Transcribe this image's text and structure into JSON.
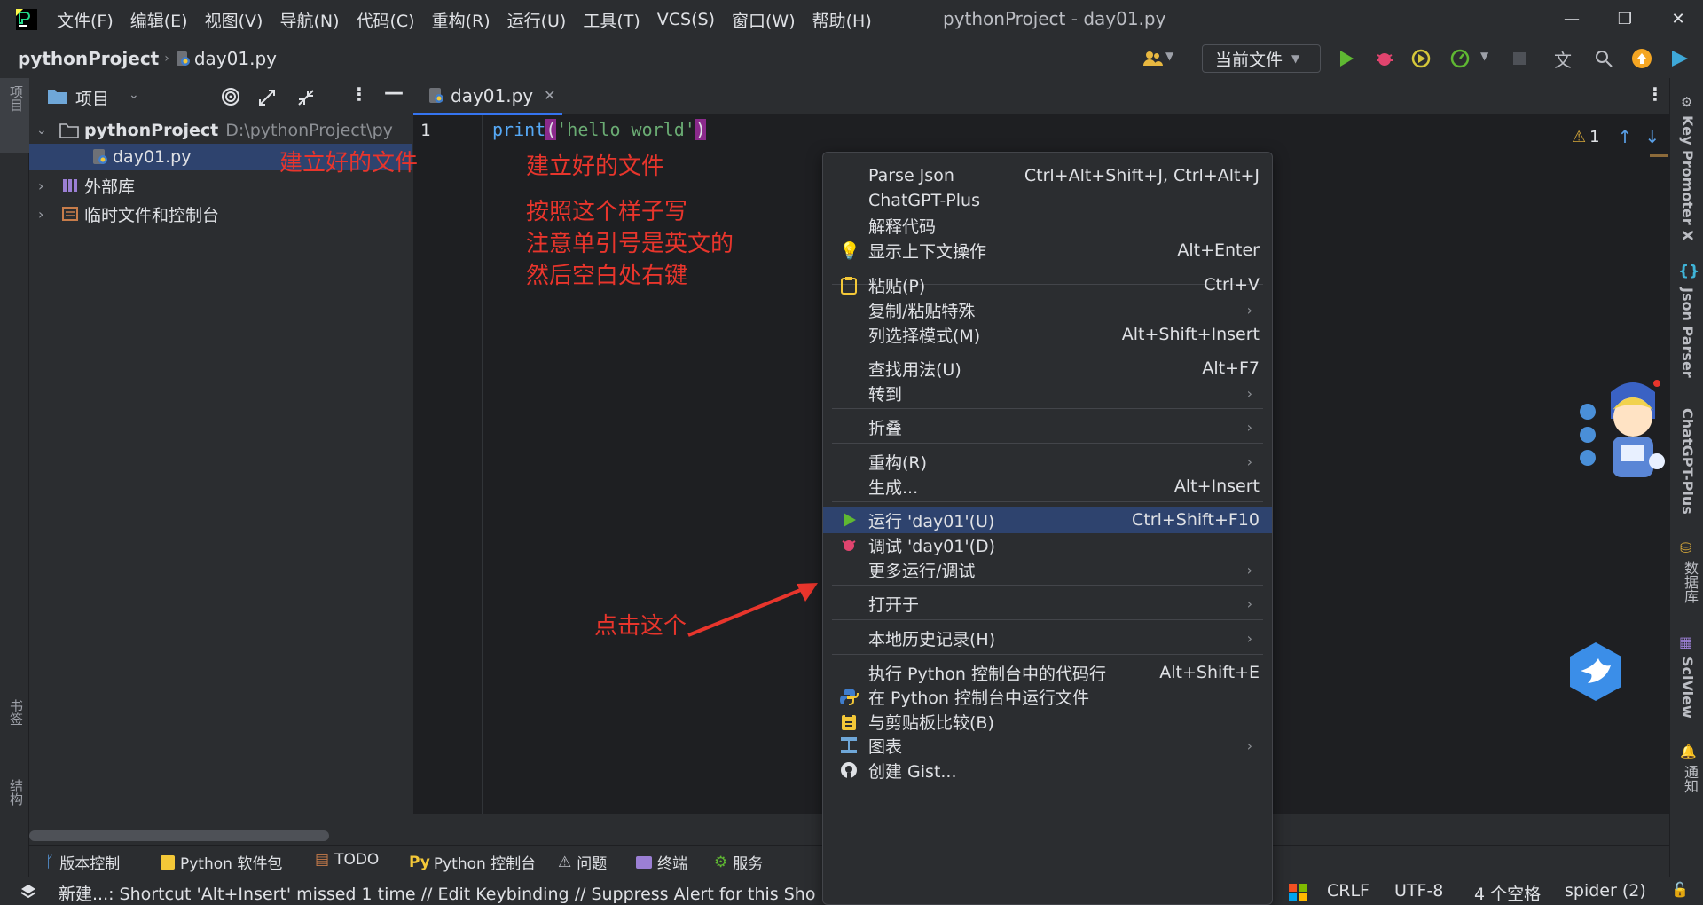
{
  "window": {
    "title": "pythonProject - day01.py",
    "menu": [
      "文件(F)",
      "编辑(E)",
      "视图(V)",
      "导航(N)",
      "代码(C)",
      "重构(R)",
      "运行(U)",
      "工具(T)",
      "VCS(S)",
      "窗口(W)",
      "帮助(H)"
    ],
    "controls": {
      "minimize": "—",
      "restore": "❐",
      "close": "✕"
    }
  },
  "navbar": {
    "project": "pythonProject",
    "file": "day01.py",
    "run_config": "当前文件"
  },
  "left_strip": {
    "project_label": "项目",
    "bookmarks_label": "书签",
    "structure_label": "结构"
  },
  "project_panel": {
    "header_label": "项目",
    "tree": [
      {
        "name": "pythonProject",
        "path": "D:\\pythonProject\\py"
      },
      {
        "name": "day01.py"
      },
      {
        "name": "外部库"
      },
      {
        "name": "临时文件和控制台"
      }
    ]
  },
  "editor": {
    "tab_label": "day01.py",
    "line_number": "1",
    "code": {
      "func": "print",
      "open": "(",
      "string": "'hello world'",
      "close": ")"
    },
    "inspection_count": "1"
  },
  "annotations": {
    "file_created": "建立好的文件",
    "instructions": [
      "按照这个样子写",
      "注意单引号是英文的",
      "然后空白处右键"
    ],
    "click_this": "点击这个"
  },
  "context_menu": {
    "items": [
      {
        "label": "Parse Json",
        "shortcut": "Ctrl+Alt+Shift+J, Ctrl+Alt+J"
      },
      {
        "label": "ChatGPT-Plus",
        "shortcut": ""
      },
      {
        "label": "解释代码",
        "shortcut": ""
      },
      {
        "label": "显示上下文操作",
        "shortcut": "Alt+Enter"
      },
      {
        "label": "粘贴(P)",
        "shortcut": "Ctrl+V"
      },
      {
        "label": "复制/粘贴特殊",
        "shortcut": ""
      },
      {
        "label": "列选择模式(M)",
        "shortcut": "Alt+Shift+Insert"
      },
      {
        "label": "查找用法(U)",
        "shortcut": "Alt+F7"
      },
      {
        "label": "转到",
        "shortcut": ""
      },
      {
        "label": "折叠",
        "shortcut": ""
      },
      {
        "label": "重构(R)",
        "shortcut": ""
      },
      {
        "label": "生成...",
        "shortcut": "Alt+Insert"
      },
      {
        "label": "运行 'day01'(U)",
        "shortcut": "Ctrl+Shift+F10"
      },
      {
        "label": "调试 'day01'(D)",
        "shortcut": ""
      },
      {
        "label": "更多运行/调试",
        "shortcut": ""
      },
      {
        "label": "打开于",
        "shortcut": ""
      },
      {
        "label": "本地历史记录(H)",
        "shortcut": ""
      },
      {
        "label": "执行 Python 控制台中的代码行",
        "shortcut": "Alt+Shift+E"
      },
      {
        "label": "在 Python 控制台中运行文件",
        "shortcut": ""
      },
      {
        "label": "与剪贴板比较(B)",
        "shortcut": ""
      },
      {
        "label": "图表",
        "shortcut": ""
      },
      {
        "label": "创建 Gist...",
        "shortcut": ""
      }
    ],
    "submenu_arrow": "›"
  },
  "right_strip": [
    "Key Promoter X",
    "Json Parser",
    "ChatGPT-Plus",
    "数据库",
    "SciView",
    "通知"
  ],
  "bottom_tools": [
    "版本控制",
    "Python 软件包",
    "TODO",
    "Python 控制台",
    "问题",
    "终端",
    "服务"
  ],
  "statusbar": {
    "message": "新建...: Shortcut 'Alt+Insert' missed 1 time // Edit Keybinding // Suppress Alert for this Sho",
    "line_sep": "CRLF",
    "encoding": "UTF-8",
    "indent": "4 个空格",
    "interpreter": "spider (2)"
  },
  "colors": {
    "accent": "#3574f0",
    "selection": "#2e436e",
    "annotation": "#e8352c",
    "run_green": "#5fb832",
    "debug_red": "#e0446e"
  }
}
